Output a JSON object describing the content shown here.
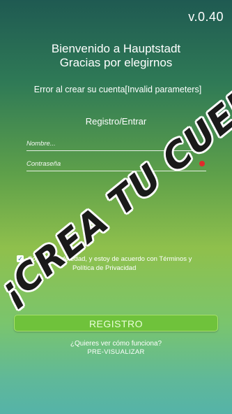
{
  "app": {
    "version": "v.0.40"
  },
  "welcome": {
    "line1": "Bienvenido a Hauptstadt",
    "line2": "Gracias por elegirnos"
  },
  "error_message": "Error al crear su cuenta[Invalid parameters]",
  "form": {
    "title": "Registro/Entrar",
    "name_placeholder": "Nombre...",
    "password_placeholder": "Contraseña",
    "password_error_color": "#e02b2b"
  },
  "consent": {
    "checked": true,
    "text": "Soy mayor de edad, y estoy de acuerdo con",
    "terms_link": "Términos y",
    "privacy_link": "Política de Privacidad"
  },
  "register_button": "REGISTRO",
  "how_it_works": "¿Quieres ver cómo funciona?",
  "preview_link": "PRE-VISUALIZAR",
  "watermark": "¡CREA TU CUENTA!",
  "colors": {
    "button": "#6fc23b",
    "background_top": "#1f5a52",
    "background_bottom": "#55b3a8"
  }
}
